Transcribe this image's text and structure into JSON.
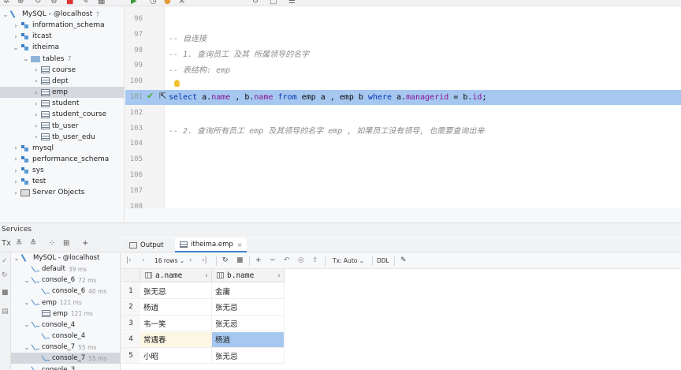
{
  "db_tree": {
    "items": [
      {
        "label": "MySQL - @localhost",
        "count": "7",
        "type": "conn",
        "arrow": "⌄",
        "indent": 0
      },
      {
        "label": "information_schema",
        "count": "",
        "type": "db",
        "arrow": "›",
        "indent": 1
      },
      {
        "label": "itcast",
        "count": "",
        "type": "db",
        "arrow": "›",
        "indent": 1
      },
      {
        "label": "itheima",
        "count": "",
        "type": "db",
        "arrow": "⌄",
        "indent": 1
      },
      {
        "label": "tables",
        "count": "7",
        "type": "folder",
        "arrow": "⌄",
        "indent": 2
      },
      {
        "label": "course",
        "count": "",
        "type": "table",
        "arrow": "›",
        "indent": 3
      },
      {
        "label": "dept",
        "count": "",
        "type": "table",
        "arrow": "›",
        "indent": 3
      },
      {
        "label": "emp",
        "count": "",
        "type": "table",
        "arrow": "›",
        "indent": 3,
        "selected": true
      },
      {
        "label": "student",
        "count": "",
        "type": "table",
        "arrow": "›",
        "indent": 3
      },
      {
        "label": "student_course",
        "count": "",
        "type": "table",
        "arrow": "›",
        "indent": 3
      },
      {
        "label": "tb_user",
        "count": "",
        "type": "table",
        "arrow": "›",
        "indent": 3
      },
      {
        "label": "tb_user_edu",
        "count": "",
        "type": "table",
        "arrow": "›",
        "indent": 3
      },
      {
        "label": "mysql",
        "count": "",
        "type": "db",
        "arrow": "›",
        "indent": 1
      },
      {
        "label": "performance_schema",
        "count": "",
        "type": "db",
        "arrow": "›",
        "indent": 1
      },
      {
        "label": "sys",
        "count": "",
        "type": "db",
        "arrow": "›",
        "indent": 1
      },
      {
        "label": "test",
        "count": "",
        "type": "db",
        "arrow": "›",
        "indent": 1
      },
      {
        "label": "Server Objects",
        "count": "",
        "type": "srv",
        "arrow": "›",
        "indent": 1
      }
    ]
  },
  "editor": {
    "line_numbers": [
      "96",
      "97",
      "98",
      "99",
      "100",
      "101",
      "102",
      "103",
      "104",
      "105",
      "106",
      "107",
      "108"
    ],
    "comment_1": "-- 自连接",
    "comment_2": "-- 1. 查询员工 及其 所属领导的名字",
    "comment_3": "-- 表结构: emp",
    "sql": {
      "select": "select ",
      "a1": "a.",
      "name1": "name",
      "c1": " , ",
      "b1": "b.",
      "name2": "name",
      "from": " from ",
      "t1": "emp a , emp b ",
      "where": "where ",
      "a2": "a.",
      "mgr": "managerid",
      "eq": " = ",
      "b2": "b.",
      "id": "id",
      "end": ";"
    },
    "comment_4": "-- 2. 查询所有员工 emp 及其领导的名字 emp , 如果员工没有领导, 也需要查询出来"
  },
  "services": {
    "title": "Services",
    "tree": [
      {
        "label": "MySQL - @localhost",
        "count": "",
        "type": "conn",
        "arrow": "⌄",
        "indent": 0
      },
      {
        "label": "default",
        "count": "39 ms",
        "type": "console",
        "arrow": "",
        "indent": 1
      },
      {
        "label": "console_6",
        "count": "72 ms",
        "type": "console",
        "arrow": "⌄",
        "indent": 1
      },
      {
        "label": "console_6",
        "count": "40 ms",
        "type": "console",
        "arrow": "",
        "indent": 2
      },
      {
        "label": "emp",
        "count": "121 ms",
        "type": "console",
        "arrow": "⌄",
        "indent": 1
      },
      {
        "label": "emp",
        "count": "121 ms",
        "type": "table",
        "arrow": "",
        "indent": 2
      },
      {
        "label": "console_4",
        "count": "",
        "type": "console",
        "arrow": "⌄",
        "indent": 1
      },
      {
        "label": "console_4",
        "count": "",
        "type": "console",
        "arrow": "",
        "indent": 2
      },
      {
        "label": "console_7",
        "count": "55 ms",
        "type": "console",
        "arrow": "⌄",
        "indent": 1
      },
      {
        "label": "console_7",
        "count": "55 ms",
        "type": "console",
        "arrow": "",
        "indent": 2,
        "selected": true
      },
      {
        "label": "console_3",
        "count": "",
        "type": "console",
        "arrow": "⌄",
        "indent": 1
      }
    ]
  },
  "tabs": {
    "output": "Output",
    "table": "itheima.emp",
    "close": "×"
  },
  "results_toolbar": {
    "rows": "16 rows",
    "tx": "Tx: Auto",
    "ddl": "DDL"
  },
  "grid": {
    "columns": [
      "a.name",
      "b.name"
    ],
    "rows": [
      {
        "n": "1",
        "a": "张无忌",
        "b": "金庸"
      },
      {
        "n": "2",
        "a": "杨逍",
        "b": "张无忌"
      },
      {
        "n": "3",
        "a": "韦一笑",
        "b": "张无忌"
      },
      {
        "n": "4",
        "a": "常遇春",
        "b": "杨逍"
      },
      {
        "n": "5",
        "a": "小昭",
        "b": "张无忌"
      }
    ]
  }
}
